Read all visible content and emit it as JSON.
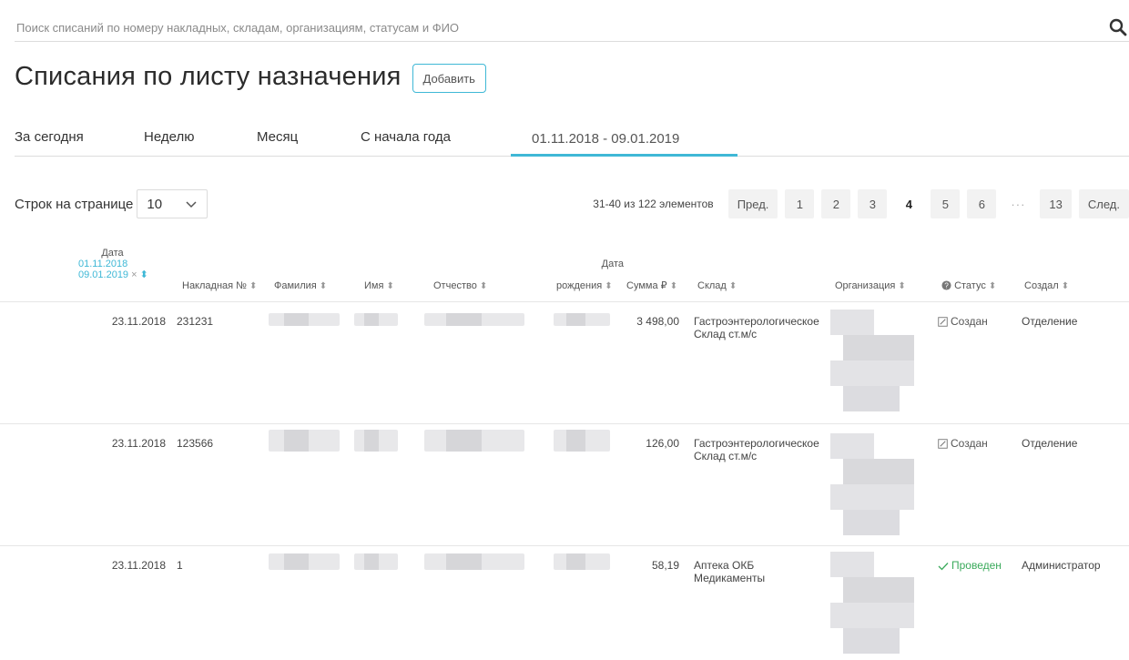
{
  "search": {
    "placeholder": "Поиск списаний по номеру накладных, складам, организациям, статусам и ФИО",
    "icon": "search-icon"
  },
  "header": {
    "title": "Списания по листу назначения",
    "add_label": "Добавить"
  },
  "tabs": [
    {
      "label": "За сегодня"
    },
    {
      "label": "Неделю"
    },
    {
      "label": "Месяц"
    },
    {
      "label": "С начала года"
    },
    {
      "label": "01.11.2018 - 09.01.2019",
      "active": true
    }
  ],
  "pagination": {
    "rows_label": "Строк на странице",
    "rows_value": "10",
    "info": "31-40 из 122 элементов",
    "prev": "Пред.",
    "next": "След.",
    "pages": [
      "1",
      "2",
      "3",
      "4",
      "5",
      "6"
    ],
    "current": "4",
    "dots": "···",
    "last": "13"
  },
  "columns": {
    "date": "Дата",
    "date_from": "01.11.2018",
    "date_to": "09.01.2019",
    "invoice": "Накладная №",
    "lastname": "Фамилия",
    "firstname": "Имя",
    "patronymic": "Отчество",
    "birth_1": "Дата",
    "birth_2": "рождения",
    "sum": "Сумма ₽",
    "warehouse": "Склад",
    "organization": "Организация",
    "status": "Статус",
    "creator": "Создал"
  },
  "rows": [
    {
      "date": "23.11.2018",
      "invoice": "231231",
      "sum": "3 498,00",
      "warehouse_1": "Гастроэнтерологическое",
      "warehouse_2": "Склад ст.м/с",
      "status": "Создан",
      "creator": "Отделение"
    },
    {
      "date": "23.11.2018",
      "invoice": "123566",
      "sum": "126,00",
      "warehouse_1": "Гастроэнтерологическое",
      "warehouse_2": "Склад ст.м/с",
      "status": "Создан",
      "creator": "Отделение"
    },
    {
      "date": "23.11.2018",
      "invoice": "1",
      "sum": "58,19",
      "warehouse_1": "Аптека ОКБ",
      "warehouse_2": "Медикаменты",
      "status": "Проведен",
      "creator": "Администратор"
    }
  ],
  "colors": {
    "accent": "#3fb8d6",
    "status_done": "#3aaa5b"
  }
}
